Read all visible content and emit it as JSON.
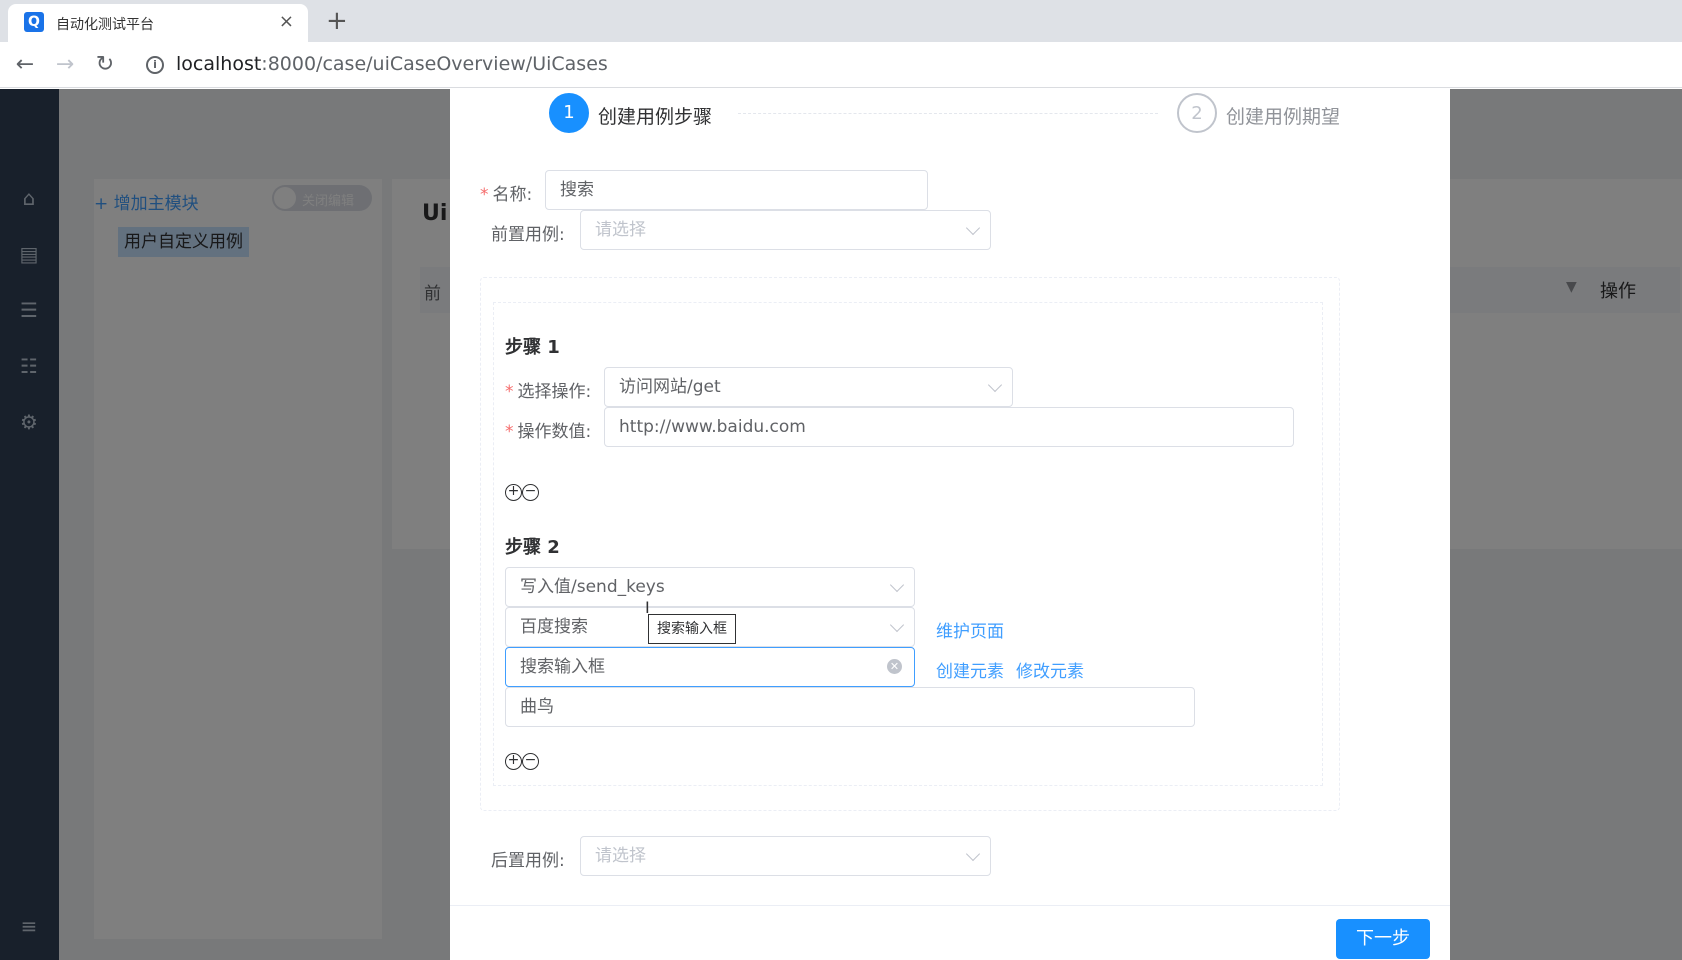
{
  "browser": {
    "tab_title": "自动化测试平台",
    "favicon": "Q",
    "close": "×",
    "new_tab": "+",
    "url_host": "localhost",
    "url_path": ":8000/case/uiCaseOverview/UiCases"
  },
  "background": {
    "add_module": "+ 增加主模块",
    "toggle_label": "关闭编辑",
    "tree_node": "用户自定义用例",
    "title_partial": "Ui",
    "header_left": "前",
    "header_ops": "操作"
  },
  "dialog": {
    "steps": [
      {
        "number": "1",
        "title": "创建用例步骤"
      },
      {
        "number": "2",
        "title": "创建用例期望"
      }
    ],
    "name_label": "名称:",
    "name_value": "搜索",
    "pre_case_label": "前置用例:",
    "pre_case_placeholder": "请选择",
    "step1": {
      "heading": "步骤 1",
      "op_label": "选择操作:",
      "op_value": "访问网站/get",
      "val_label": "操作数值:",
      "val_value": "http://www.baidu.com"
    },
    "step2": {
      "heading": "步骤 2",
      "op_value": "写入值/send_keys",
      "page_value": "百度搜索",
      "page_link": "维护页面",
      "element_value": "搜索输入框",
      "create_element": "创建元素",
      "modify_element": "修改元素",
      "input_value": "曲鸟",
      "tooltip": "搜索输入框"
    },
    "plus": "+",
    "minus": "−",
    "post_case_label": "后置用例:",
    "post_case_placeholder": "请选择",
    "next_button": "下一步"
  },
  "colors": {
    "primary": "#1890ff",
    "link": "#409eff",
    "required": "#f56c6c",
    "sidebar": "#304156"
  }
}
